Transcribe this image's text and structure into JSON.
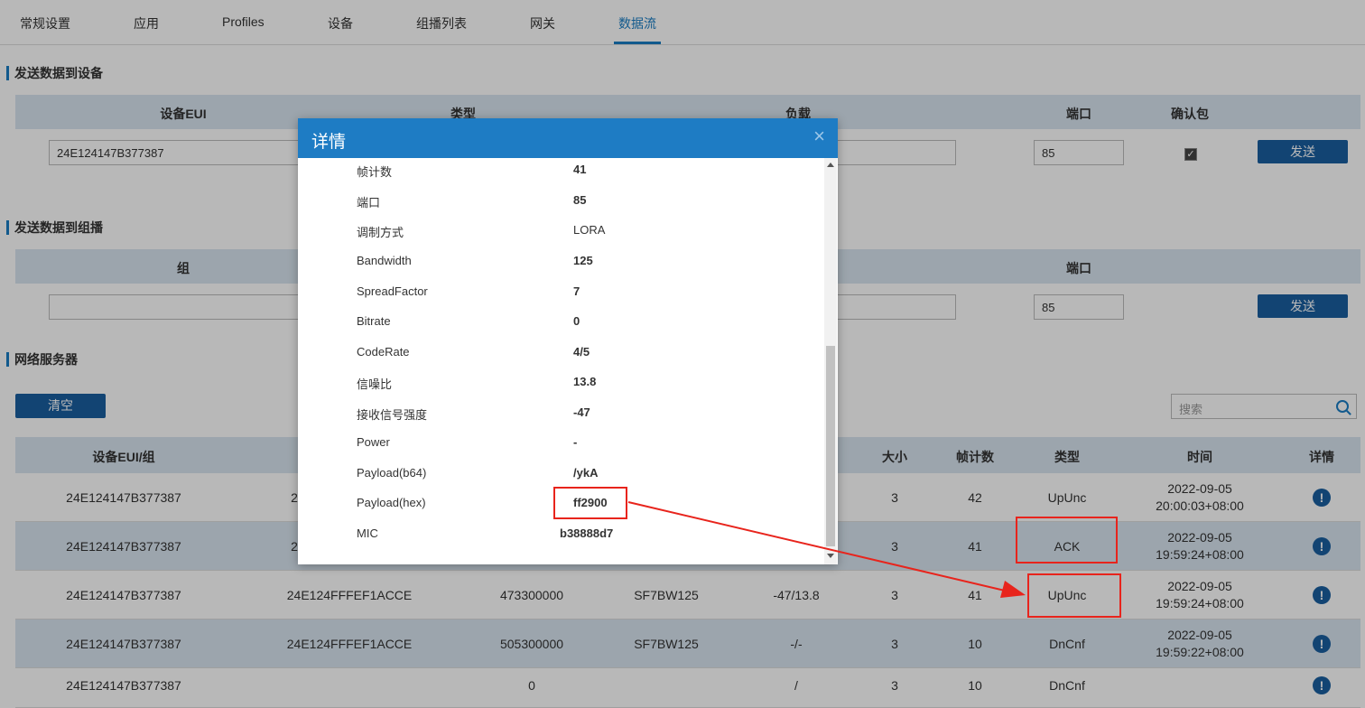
{
  "tabs": [
    "常规设置",
    "应用",
    "Profiles",
    "设备",
    "组播列表",
    "网关",
    "数据流"
  ],
  "active_tab": "数据流",
  "colors": {
    "accent": "#1a7dc4",
    "button": "#1a5fa0",
    "header_row": "#d9e5f0",
    "highlight": "#e8241c"
  },
  "send_device": {
    "title": "发送数据到设备",
    "headers": {
      "eui": "设备EUI",
      "type": "类型",
      "payload": "负载",
      "port": "端口",
      "ack": "确认包"
    },
    "eui_value": "24E124147B377387",
    "port_value": "85",
    "ack_checked": true,
    "send_label": "发送"
  },
  "send_multicast": {
    "title": "发送数据到组播",
    "headers": {
      "group": "组",
      "port": "端口"
    },
    "group_value": "",
    "port_value": "85",
    "send_label": "发送"
  },
  "network_server": {
    "title": "网络服务器",
    "clear_label": "清空",
    "search_placeholder": "搜索",
    "headers": {
      "eui_group": "设备EUI/组",
      "size": "大小",
      "fcnt": "帧计数",
      "type": "类型",
      "time": "时间",
      "detail": "详情"
    },
    "rows": [
      {
        "eui": "24E124147B377387",
        "gateway": "2",
        "freq": "",
        "datarate": "",
        "rssi_snr": "",
        "size": "3",
        "fcnt": "42",
        "type": "UpUnc",
        "date": "2022-09-05",
        "time": "20:00:03+08:00"
      },
      {
        "eui": "24E124147B377387",
        "gateway": "2",
        "freq": "",
        "datarate": "",
        "rssi_snr": "",
        "size": "3",
        "fcnt": "41",
        "type": "ACK",
        "date": "2022-09-05",
        "time": "19:59:24+08:00"
      },
      {
        "eui": "24E124147B377387",
        "gateway": "24E124FFFEF1ACCE",
        "freq": "473300000",
        "datarate": "SF7BW125",
        "rssi_snr": "-47/13.8",
        "size": "3",
        "fcnt": "41",
        "type": "UpUnc",
        "date": "2022-09-05",
        "time": "19:59:24+08:00"
      },
      {
        "eui": "24E124147B377387",
        "gateway": "24E124FFFEF1ACCE",
        "freq": "505300000",
        "datarate": "SF7BW125",
        "rssi_snr": "-/-",
        "size": "3",
        "fcnt": "10",
        "type": "DnCnf",
        "date": "2022-09-05",
        "time": "19:59:22+08:00"
      },
      {
        "eui": "24E124147B377387",
        "gateway": "",
        "freq": "0",
        "datarate": "",
        "rssi_snr": "/",
        "size": "3",
        "fcnt": "10",
        "type": "DnCnf",
        "date": "",
        "time": ""
      }
    ],
    "detail_icon": "info-icon"
  },
  "modal": {
    "title": "详情",
    "close_icon": "×",
    "items": [
      {
        "label": "帧计数",
        "value": "41"
      },
      {
        "label": "端口",
        "value": "85"
      },
      {
        "label": "调制方式",
        "value": "LORA"
      },
      {
        "label": "Bandwidth",
        "value": "125"
      },
      {
        "label": "SpreadFactor",
        "value": "7"
      },
      {
        "label": "Bitrate",
        "value": "0"
      },
      {
        "label": "CodeRate",
        "value": "4/5"
      },
      {
        "label": "信噪比",
        "value": "13.8"
      },
      {
        "label": "接收信号强度",
        "value": "-47"
      },
      {
        "label": "Power",
        "value": "-"
      },
      {
        "label": "Payload(b64)",
        "value": "/ykA"
      },
      {
        "label": "Payload(hex)",
        "value": "ff2900"
      },
      {
        "label": "MIC",
        "value": "b38888d7"
      }
    ]
  }
}
